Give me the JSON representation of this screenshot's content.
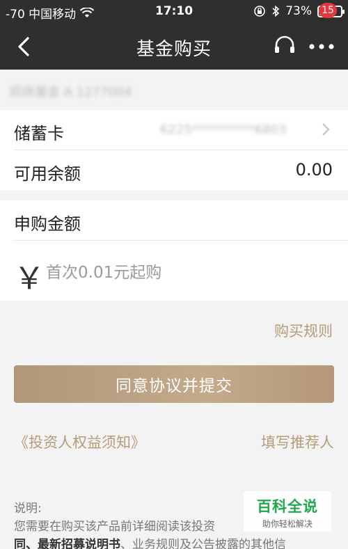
{
  "status_bar": {
    "signal": "-70 中国移动",
    "time": "17:10",
    "battery": "73%",
    "battery_level": 0.73
  },
  "nav": {
    "title": "基金购买",
    "badge_count": "15",
    "icons": [
      "back-arrow-icon",
      "headset-icon",
      "more-icon"
    ]
  },
  "fund": {
    "name_blurred": "招商基金 A 1277004"
  },
  "card_section": {
    "debit_label": "储蓄卡",
    "debit_value_blurred": "6225**********6803",
    "balance_label": "可用余额",
    "balance_value": "0.00"
  },
  "purchase_section": {
    "amount_label": "申购金额",
    "currency_symbol": "￥",
    "amount_placeholder": "首次0.01元起购"
  },
  "links": {
    "purchase_rules": "购买规则",
    "investor_rights": "《投资人权益须知》",
    "fill_referrer": "填写推荐人"
  },
  "submit_button": {
    "label": "同意协议并提交"
  },
  "notes": {
    "heading": "说明:",
    "line1": "您需要在购买该产品前详细阅读该投资",
    "line2_part1": "同、最新招募说明书",
    "line2_part2": "、业务规则及公告披露的其他信"
  },
  "watermark": {
    "main": "百科全说",
    "sub": "助你轻松解决"
  },
  "colors": {
    "navbar": "#2f2f2f",
    "accent": "#b79b78",
    "badge": "#e4393c",
    "watermark": "#1fa84d"
  }
}
